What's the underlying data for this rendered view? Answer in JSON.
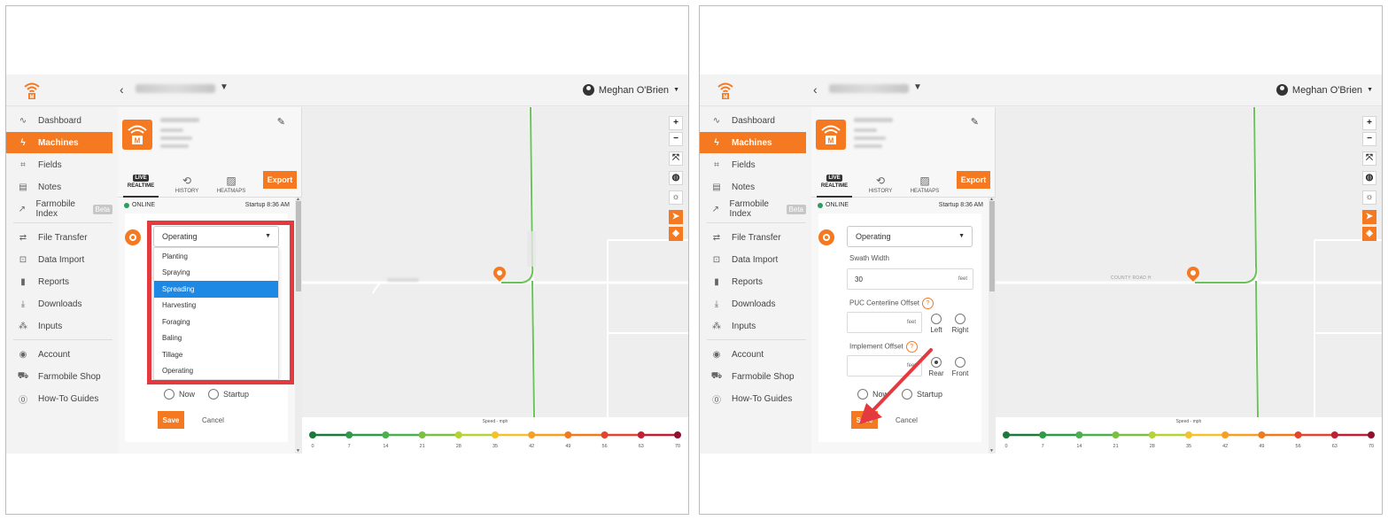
{
  "app": {
    "user_name": "Meghan O'Brien"
  },
  "sidebar": {
    "items": [
      {
        "label": "Dashboard",
        "icon": "activity-icon"
      },
      {
        "label": "Machines",
        "icon": "bolt-icon",
        "active": true
      },
      {
        "label": "Fields",
        "icon": "fields-icon"
      },
      {
        "label": "Notes",
        "icon": "note-icon"
      },
      {
        "label": "Farmobile Index",
        "icon": "trend-icon",
        "badge": "Beta"
      },
      {
        "label": "File Transfer",
        "icon": "transfer-icon"
      },
      {
        "label": "Data Import",
        "icon": "import-icon"
      },
      {
        "label": "Reports",
        "icon": "bar-chart-icon"
      },
      {
        "label": "Downloads",
        "icon": "download-icon"
      },
      {
        "label": "Inputs",
        "icon": "inputs-icon"
      },
      {
        "label": "Account",
        "icon": "account-icon"
      },
      {
        "label": "Farmobile Shop",
        "icon": "cart-icon"
      },
      {
        "label": "How-To Guides",
        "icon": "help-icon"
      }
    ]
  },
  "panel": {
    "tabs": [
      {
        "label": "REALTIME",
        "icon_text": "LIVE"
      },
      {
        "label": "HISTORY",
        "icon_text": "⟲"
      },
      {
        "label": "HEATMAPS",
        "icon_text": "▨"
      }
    ],
    "export_label": "Export",
    "status": "ONLINE",
    "startup": "Startup 8:36 AM"
  },
  "operation_form": {
    "selected": "Operating",
    "options": [
      "Planting",
      "Spraying",
      "Spreading",
      "Harvesting",
      "Foraging",
      "Baling",
      "Tillage",
      "Operating"
    ],
    "highlighted_option": "Spreading",
    "radio_now": "Now",
    "radio_startup": "Startup",
    "save_label": "Save",
    "cancel_label": "Cancel",
    "swath_width_label": "Swath Width",
    "swath_width_value": "30",
    "swath_unit": "feet",
    "puc_label": "PUC Centerline Offset",
    "puc_unit": "feet",
    "left_label": "Left",
    "right_label": "Right",
    "implement_label": "Implement Offset",
    "implement_unit": "feet",
    "rear_label": "Rear",
    "front_label": "Front",
    "help_glyph": "?"
  },
  "map": {
    "road_label": "COUNTY ROAD H",
    "controls": [
      "+",
      "−",
      "⤧",
      "◍",
      "☼",
      "➤",
      "◈"
    ],
    "legend_title": "Speed - mph",
    "legend_ticks": [
      "0",
      "7",
      "14",
      "21",
      "28",
      "35",
      "42",
      "49",
      "56",
      "63",
      "70"
    ],
    "legend_colors": [
      "#1b7a3a",
      "#2e9a4a",
      "#4caf50",
      "#7bc043",
      "#b5d334",
      "#f6c12b",
      "#f59f24",
      "#ef7a1f",
      "#e1452c",
      "#c02034",
      "#8f1030"
    ]
  },
  "colors": {
    "accent": "#f47920",
    "selected_blue": "#1e88e5",
    "annotation_red": "#e53940",
    "online_green": "#2e9e5e"
  }
}
